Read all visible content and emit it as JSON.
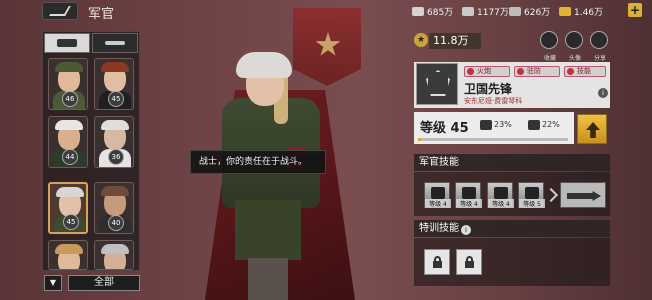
{
  "header": {
    "title": "军官",
    "resources": [
      {
        "name": "oil-icon",
        "value": "685万",
        "color": "#d4d4d4"
      },
      {
        "name": "steel-icon",
        "value": "1177万",
        "color": "#c9c9c9"
      },
      {
        "name": "ammo-icon",
        "value": "626万",
        "color": "#bdbdbd"
      },
      {
        "name": "gold-icon",
        "value": "1.46万",
        "color": "#e2b436"
      }
    ],
    "plus": "+"
  },
  "filter_tabs": [
    {
      "name": "tank-icon",
      "active": true
    },
    {
      "name": "plane-icon",
      "active": false
    }
  ],
  "officers": [
    {
      "level": "46",
      "selected": false,
      "cap": "#4b5a34",
      "skin": "#e0b99a",
      "body": "#4c5a36"
    },
    {
      "level": "45",
      "selected": false,
      "cap": "#8a3a24",
      "skin": "#e2bca3",
      "body": "#1f1f1f"
    },
    {
      "level": "44",
      "selected": false,
      "cap": "#e8e6e0",
      "skin": "#d8b08f",
      "body": "#2d3b2a"
    },
    {
      "level": "36",
      "selected": false,
      "cap": "#dedede",
      "skin": "#d7b9a3",
      "body": "#e4e4e4"
    },
    {
      "level": "45",
      "selected": true,
      "cap": "#d9d6d2",
      "skin": "#e2c1a8",
      "body": "#3f4a32"
    },
    {
      "level": "40",
      "selected": false,
      "cap": "#6f4b3b",
      "skin": "#c69a7c",
      "body": "#2e2e2e"
    },
    {
      "level": "",
      "selected": false,
      "cap": "#c79a5c",
      "skin": "#e0b89b",
      "body": "#556b35"
    },
    {
      "level": "",
      "selected": false,
      "cap": "#bfbfbf",
      "skin": "#d3b097",
      "body": "#4a4a4a"
    }
  ],
  "bottom": {
    "filter_glyph": "▼",
    "all_label": "全部"
  },
  "tooltip": "战士，你的责任在于战斗。",
  "power": {
    "value": "11.8万"
  },
  "corner_buttons": [
    {
      "name": "favorite-icon",
      "label": "收藏"
    },
    {
      "name": "avatar-icon",
      "label": "头像"
    },
    {
      "name": "share-icon",
      "label": "分享"
    }
  ],
  "officer": {
    "tags": [
      "火炮",
      "驻防",
      "技能"
    ],
    "name": "卫国先锋",
    "subtitle": "安东尼娅·费雷琴科",
    "level_label": "等级 45",
    "stat1": "23%",
    "stat2": "22%",
    "xp_progress": 0.02
  },
  "sections": {
    "skills_title": "军官技能",
    "special_title": "特训技能",
    "info_glyph": "i"
  },
  "skills": [
    {
      "label": "等级 4"
    },
    {
      "label": "等级 4"
    },
    {
      "label": "等级 4"
    },
    {
      "label": "等级 5"
    }
  ]
}
